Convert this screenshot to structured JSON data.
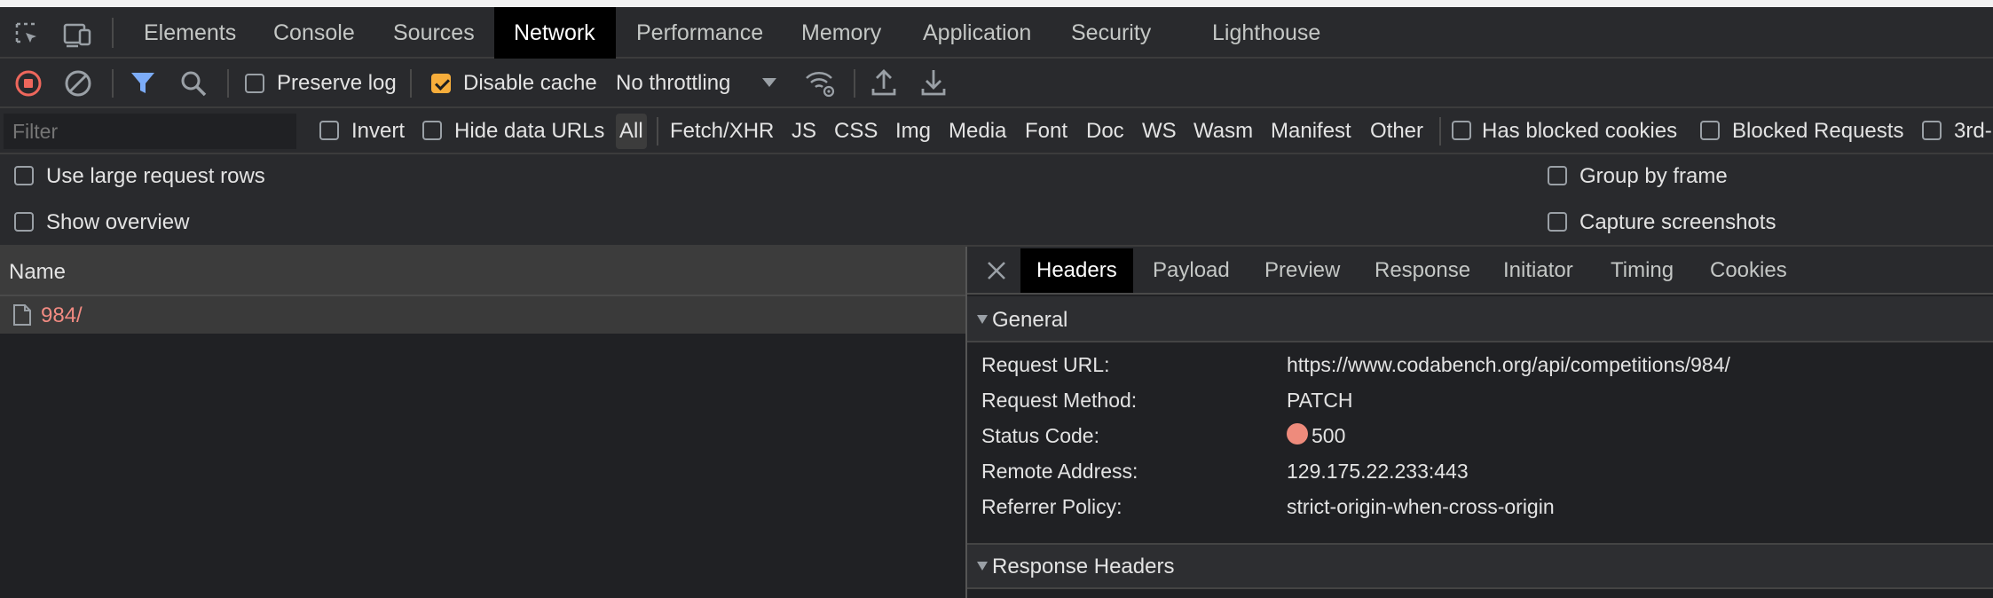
{
  "tabs": [
    {
      "label": "Elements"
    },
    {
      "label": "Console"
    },
    {
      "label": "Sources"
    },
    {
      "label": "Network"
    },
    {
      "label": "Performance"
    },
    {
      "label": "Memory"
    },
    {
      "label": "Application"
    },
    {
      "label": "Security"
    },
    {
      "label": "Lighthouse"
    }
  ],
  "toolbar": {
    "preserve_log": "Preserve log",
    "disable_cache": "Disable cache",
    "throttling": "No throttling"
  },
  "filter": {
    "placeholder": "Filter",
    "invert": "Invert",
    "hide_data_urls": "Hide data URLs",
    "types": [
      "All",
      "Fetch/XHR",
      "JS",
      "CSS",
      "Img",
      "Media",
      "Font",
      "Doc",
      "WS",
      "Wasm",
      "Manifest",
      "Other"
    ],
    "has_blocked_cookies": "Has blocked cookies",
    "blocked_requests": "Blocked Requests",
    "third_party": "3rd-"
  },
  "options": {
    "large_rows": "Use large request rows",
    "show_overview": "Show overview",
    "group_by_frame": "Group by frame",
    "capture_screenshots": "Capture screenshots"
  },
  "requests": {
    "header": "Name",
    "rows": [
      {
        "name": "984/"
      }
    ]
  },
  "details": {
    "tabs": [
      "Headers",
      "Payload",
      "Preview",
      "Response",
      "Initiator",
      "Timing",
      "Cookies"
    ],
    "general_title": "General",
    "general": {
      "request_url_label": "Request URL:",
      "request_url": "https://www.codabench.org/api/competitions/984/",
      "method_label": "Request Method:",
      "method": "PATCH",
      "status_label": "Status Code:",
      "status": "500",
      "remote_label": "Remote Address:",
      "remote": "129.175.22.233:443",
      "referrer_label": "Referrer Policy:",
      "referrer": "strict-origin-when-cross-origin"
    },
    "response_headers_title": "Response Headers"
  },
  "colors": {
    "error_red": "#f28b82",
    "status_dot": "#ee8b7c",
    "accent_blue": "#7cacf8",
    "checkbox_orange": "#f6ad3b",
    "record_red": "#ee675c"
  }
}
